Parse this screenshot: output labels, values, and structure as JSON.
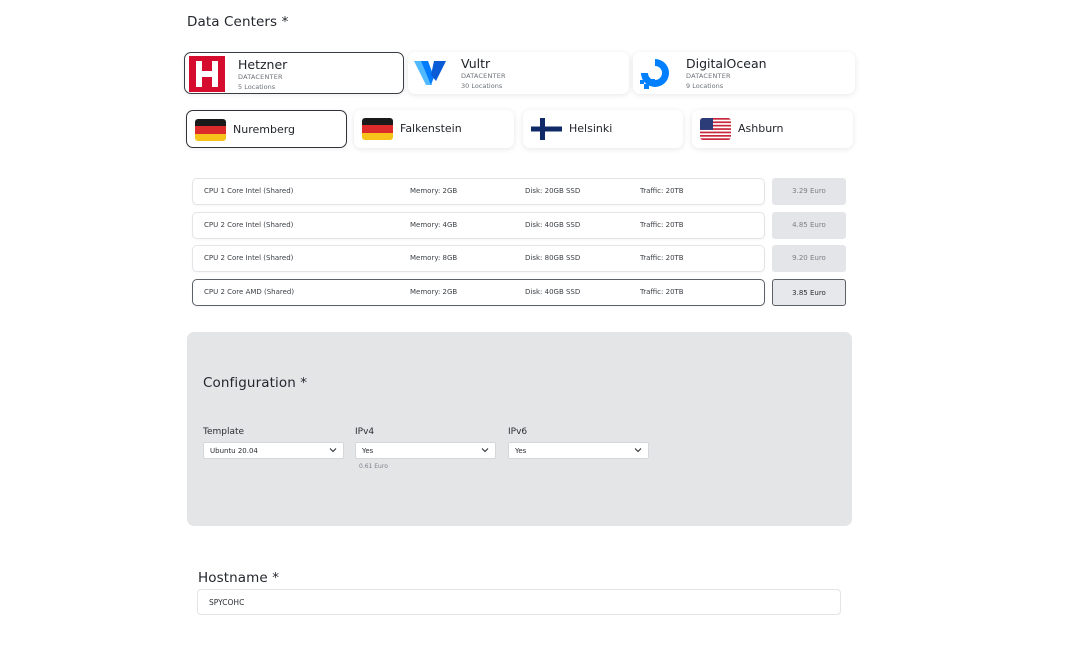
{
  "datacenters": {
    "title": "Data Centers *",
    "providers": [
      {
        "name": "Hetzner",
        "type": "DATACENTER",
        "locations": "5 Locations",
        "selected": true
      },
      {
        "name": "Vultr",
        "type": "DATACENTER",
        "locations": "30 Locations",
        "selected": false
      },
      {
        "name": "DigitalOcean",
        "type": "DATACENTER",
        "locations": "9 Locations",
        "selected": false
      }
    ],
    "locations": [
      {
        "name": "Nuremberg",
        "flag": "germany-flag",
        "selected": true
      },
      {
        "name": "Falkenstein",
        "flag": "germany-flag",
        "selected": false
      },
      {
        "name": "Helsinki",
        "flag": "finland-flag",
        "selected": false
      },
      {
        "name": "Ashburn",
        "flag": "usa-flag",
        "selected": false
      }
    ]
  },
  "plans": [
    {
      "cpu": "CPU 1 Core Intel (Shared)",
      "memory": "Memory: 2GB",
      "disk": "Disk: 20GB SSD",
      "traffic": "Traffic: 20TB",
      "price": "3.29 Euro",
      "selected": false
    },
    {
      "cpu": "CPU 2 Core Intel (Shared)",
      "memory": "Memory: 4GB",
      "disk": "Disk: 40GB SSD",
      "traffic": "Traffic: 20TB",
      "price": "4.85 Euro",
      "selected": false
    },
    {
      "cpu": "CPU 2 Core Intel (Shared)",
      "memory": "Memory: 8GB",
      "disk": "Disk: 80GB SSD",
      "traffic": "Traffic: 20TB",
      "price": "9.20 Euro",
      "selected": false
    },
    {
      "cpu": "CPU 2 Core AMD (Shared)",
      "memory": "Memory: 2GB",
      "disk": "Disk: 40GB SSD",
      "traffic": "Traffic: 20TB",
      "price": "3.85 Euro",
      "selected": true
    }
  ],
  "configuration": {
    "title": "Configuration *",
    "template": {
      "label": "Template",
      "value": "Ubuntu 20.04"
    },
    "ipv4": {
      "label": "IPv4",
      "value": "Yes",
      "note": "0.61 Euro"
    },
    "ipv6": {
      "label": "IPv6",
      "value": "Yes"
    }
  },
  "hostname": {
    "label": "Hostname *",
    "value": "SPYCOHC"
  },
  "colors": {
    "hetzner_red": "#d50c2d",
    "vultr_blue": "#007bfc",
    "digitalocean_blue": "#0080ff",
    "panel_gray": "#e4e5e7",
    "price_gray": "#e3e5e8"
  }
}
